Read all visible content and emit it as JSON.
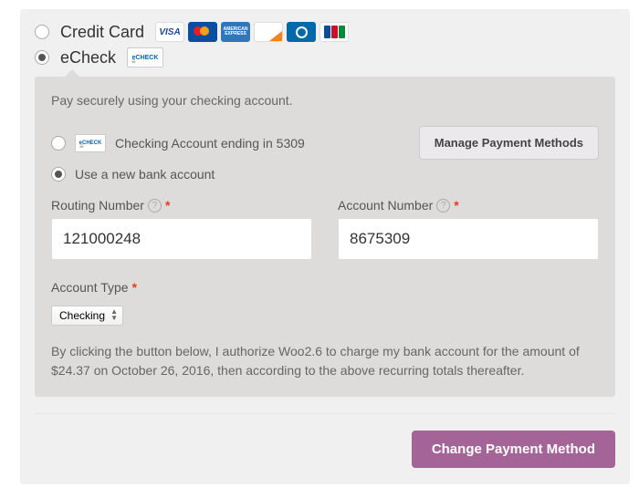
{
  "methods": {
    "credit_card": "Credit Card",
    "echeck": "eCheck"
  },
  "card_logos": {
    "visa": "VISA",
    "amex": "AMERICAN EXPRESS"
  },
  "echeck_logo": "eCHECK",
  "form": {
    "description": "Pay securely using your checking account.",
    "saved_account_label": "Checking Account ending in 5309",
    "use_new_label": "Use a new bank account",
    "manage_button": "Manage Payment Methods",
    "routing_label": "Routing Number",
    "account_label": "Account Number",
    "routing_value": "121000248",
    "account_value": "8675309",
    "account_type_label": "Account Type",
    "account_type_value": "Checking",
    "required_mark": "*",
    "consent": "By clicking the button below, I authorize Woo2.6 to charge my bank account for the amount of $24.37 on October 26, 2016, then according to the above recurring totals thereafter."
  },
  "submit_label": "Change Payment Method"
}
